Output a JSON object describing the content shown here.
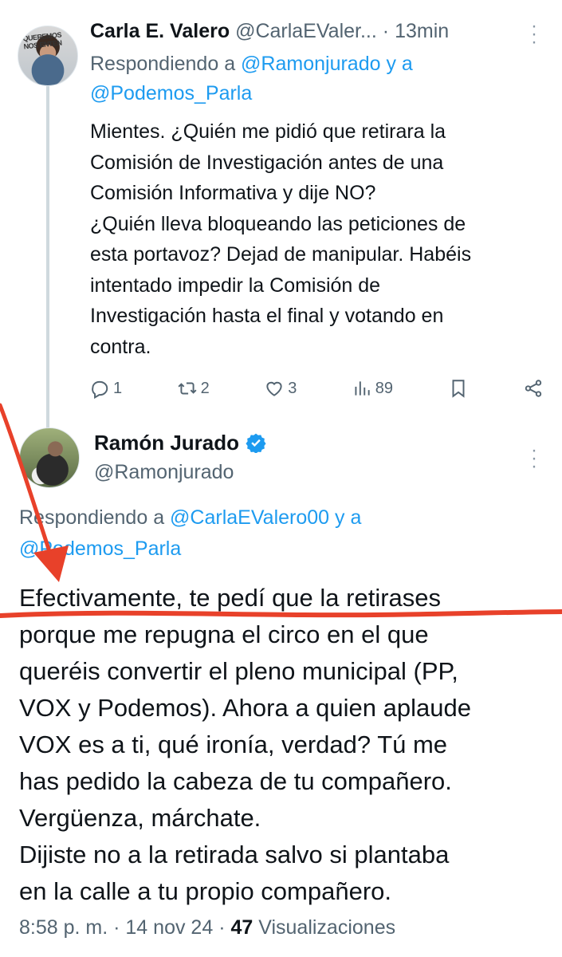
{
  "reply_tweet": {
    "author_name": "Carla E. Valero",
    "author_handle": "@CarlaEValer...",
    "separator": "·",
    "time": "13min",
    "avatar_sign": "QUEREMOS\nNOS ENTEN",
    "replying_prefix": "Respondiendo a ",
    "replying_to_1": "@Ramonjurado",
    "replying_joiner": " y a ",
    "replying_to_2": "@Podemos_Parla",
    "text": "Mientes. ¿Quién me pidió que retirara la\nComisión de Investigación antes de una\nComisión Informativa y dije NO?\n¿Quién lleva bloqueando las peticiones de\nesta portavoz? Dejad de manipular. Habéis\nintentado impedir la Comisión de\nInvestigación hasta el final y votando en\ncontra.",
    "replies": "1",
    "reposts": "2",
    "likes": "3",
    "views": "89"
  },
  "main_tweet": {
    "author_name": "Ramón Jurado",
    "author_handle": "@Ramonjurado",
    "replying_prefix": "Respondiendo a ",
    "replying_to_1": "@CarlaEValero00",
    "replying_joiner": " y a",
    "replying_to_2": "@Podemos_Parla",
    "text": "Efectivamente, te pedí que la retirases\nporque me repugna el circo en el que\nqueréis convertir el pleno municipal (PP,\nVOX y Podemos). Ahora a quien aplaude\nVOX es a ti, qué ironía, verdad? Tú me\nhas pedido la cabeza de tu compañero.\nVergüenza, márchate.\nDijiste no a la retirada salvo si plantaba\nen la calle a tu propio compañero.",
    "time": "8:58 p. m.",
    "separator": "·",
    "date": "14 nov 24",
    "views_count": "47",
    "views_label": "Visualizaciones"
  },
  "colors": {
    "accent": "#1d9bf0",
    "secondary_text": "#536471",
    "annotation": "#e8412a"
  },
  "icons": [
    "more-icon",
    "reply-icon",
    "repost-icon",
    "like-icon",
    "views-icon",
    "bookmark-icon",
    "share-icon",
    "verified-badge-icon"
  ]
}
